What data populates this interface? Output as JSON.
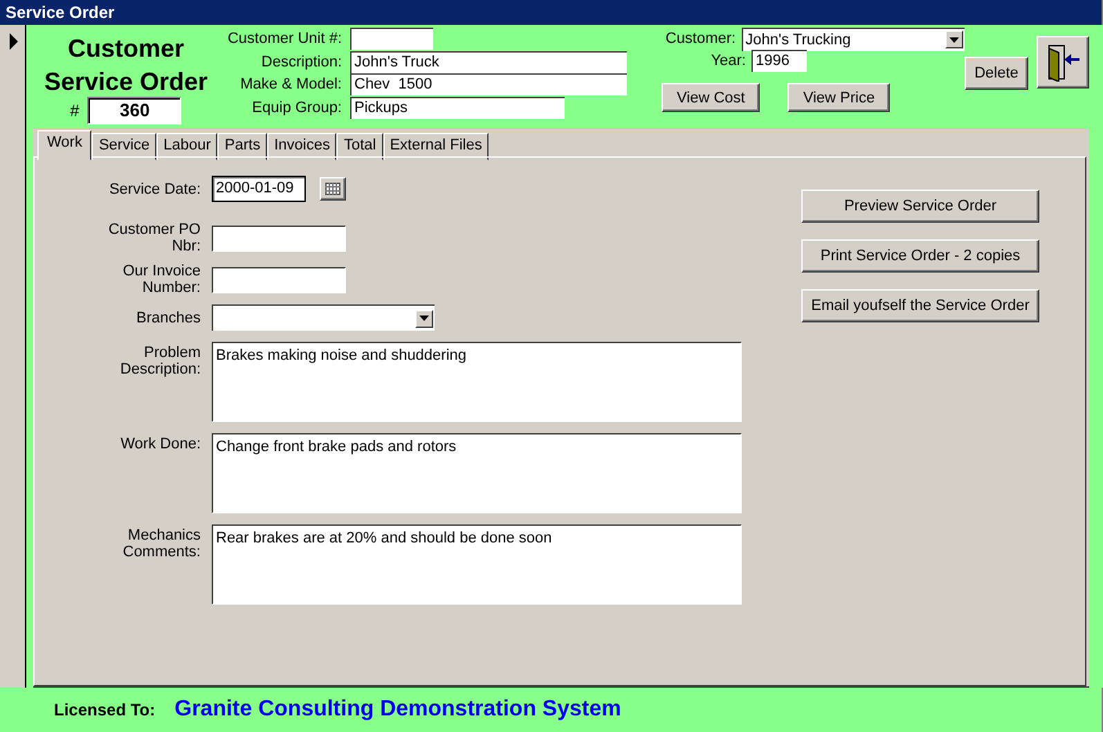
{
  "window": {
    "title": "Service Order"
  },
  "header": {
    "title_lines": [
      "Customer",
      "Service Order"
    ],
    "number_label": "#",
    "number": "360",
    "fields": [
      {
        "label": "Customer Unit #:"
      },
      {
        "label": "Description:",
        "value": "John's Truck"
      },
      {
        "label": "Make & Model:",
        "value": "Chev  1500"
      },
      {
        "label": "Equip Group:",
        "value": "Pickups"
      }
    ],
    "customer": {
      "label": "Customer:",
      "value": "John's Trucking"
    },
    "year": {
      "label": "Year:",
      "value": "1996"
    },
    "buttons": [
      "View Cost",
      "View Price"
    ],
    "delete_button": "Delete"
  },
  "tabs": [
    {
      "label": "Work",
      "selected": true
    },
    {
      "label": "Service",
      "selected": false
    },
    {
      "label": "Labour",
      "selected": false
    },
    {
      "label": "Parts",
      "selected": false
    },
    {
      "label": "Invoices",
      "selected": false
    },
    {
      "label": "Total",
      "selected": false
    },
    {
      "label": "External Files",
      "selected": false
    }
  ],
  "work_form": {
    "fields": [
      {
        "kind": "date",
        "label": "Service Date:",
        "value": "2000-01-09"
      },
      {
        "kind": "text",
        "label": "Customer PO Nbr:"
      },
      {
        "kind": "text",
        "label": "Our Invoice Number:"
      },
      {
        "kind": "combo",
        "label": "Branches"
      },
      {
        "kind": "memo",
        "label": "Problem Description:",
        "value": "Brakes making noise and shuddering"
      },
      {
        "kind": "memo",
        "label": "Work Done:",
        "value": "Change front brake pads and rotors"
      },
      {
        "kind": "memo",
        "label": "Mechanics Comments:",
        "value": "Rear brakes are at 20% and should be done soon"
      }
    ],
    "actions": [
      "Preview Service Order",
      "Print Service Order - 2 copies",
      "Email youfself the Service Order"
    ]
  },
  "footer": {
    "label": "Licensed To:",
    "value": "Granite Consulting Demonstration System"
  }
}
